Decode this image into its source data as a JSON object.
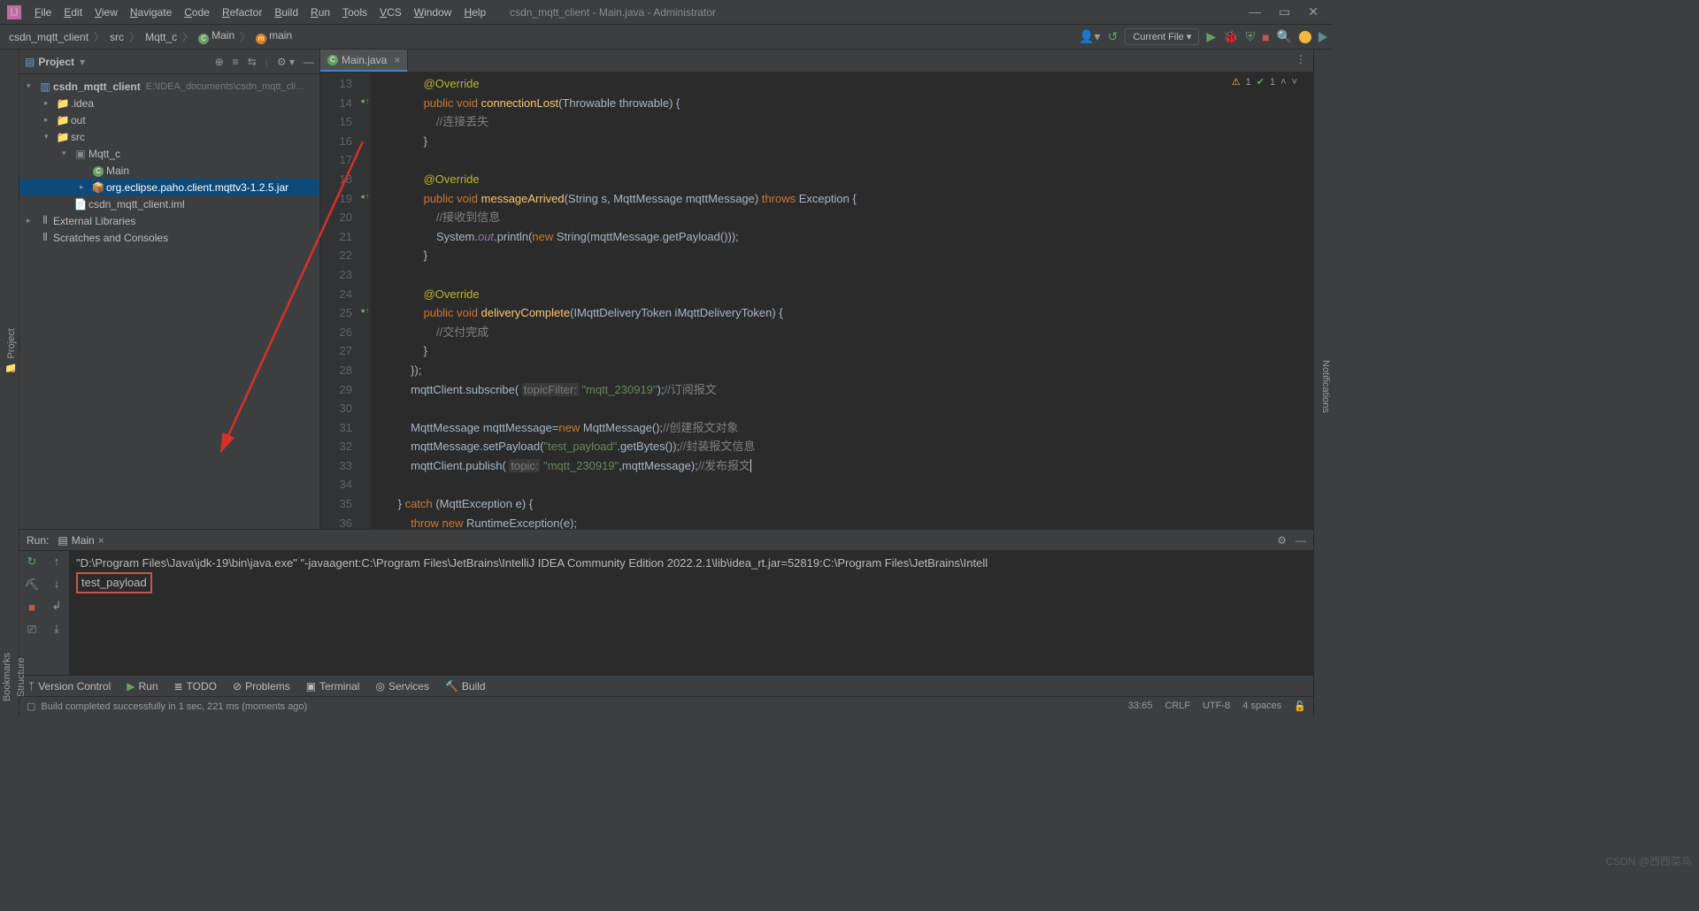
{
  "window": {
    "title": "csdn_mqtt_client - Main.java - Administrator",
    "menus": [
      "File",
      "Edit",
      "View",
      "Navigate",
      "Code",
      "Refactor",
      "Build",
      "Run",
      "Tools",
      "VCS",
      "Window",
      "Help"
    ]
  },
  "breadcrumbs": {
    "items": [
      "csdn_mqtt_client",
      "src",
      "Mqtt_c",
      "Main",
      "main"
    ]
  },
  "toolbar_right": {
    "current_file": "Current File"
  },
  "project_panel": {
    "title": "Project",
    "root": {
      "name": "csdn_mqtt_client",
      "path": "E:\\IDEA_documents\\csdn_mqtt_cli…"
    },
    "nodes": {
      "idea": ".idea",
      "out": "out",
      "src": "src",
      "pkg": "Mqtt_c",
      "main": "Main",
      "jar": "org.eclipse.paho.client.mqttv3-1.2.5.jar",
      "iml": "csdn_mqtt_client.iml",
      "ext": "External Libraries",
      "scratch": "Scratches and Consoles"
    }
  },
  "editor": {
    "tab": "Main.java",
    "warnings": "1",
    "oks": "1",
    "line_start": 13,
    "lines": [
      {
        "n": 13,
        "html": "              <span class='ann'>@Override</span>"
      },
      {
        "n": 14,
        "html": "              <span class='kw'>public void</span> <span class='fn'>connectionLost</span>(Throwable throwable) {",
        "m": 1
      },
      {
        "n": 15,
        "html": "                  <span class='cmt'>//连接丢失</span>"
      },
      {
        "n": 16,
        "html": "              }"
      },
      {
        "n": 17,
        "html": ""
      },
      {
        "n": 18,
        "html": "              <span class='ann'>@Override</span>"
      },
      {
        "n": 19,
        "html": "              <span class='kw'>public void</span> <span class='fn'>messageArrived</span>(String s, MqttMessage mqttMessage) <span class='kw'>throws</span> Exception {",
        "m": 1
      },
      {
        "n": 20,
        "html": "                  <span class='cmt'>//接收到信息</span>"
      },
      {
        "n": 21,
        "html": "                  System.<span class='out'>out</span>.println(<span class='kw'>new</span> String(mqttMessage.getPayload()));"
      },
      {
        "n": 22,
        "html": "              }"
      },
      {
        "n": 23,
        "html": ""
      },
      {
        "n": 24,
        "html": "              <span class='ann'>@Override</span>"
      },
      {
        "n": 25,
        "html": "              <span class='kw'>public void</span> <span class='fn'>deliveryComplete</span>(IMqttDeliveryToken iMqttDeliveryToken) {",
        "m": 1
      },
      {
        "n": 26,
        "html": "                  <span class='cmt'>//交付完成</span>"
      },
      {
        "n": 27,
        "html": "              }"
      },
      {
        "n": 28,
        "html": "          });"
      },
      {
        "n": 29,
        "html": "          mqttClient.subscribe( <span class='hint'>topicFilter:</span> <span class='str'>\"mqtt_230919\"</span>);<span class='cmt'>//订阅报文</span>"
      },
      {
        "n": 30,
        "html": ""
      },
      {
        "n": 31,
        "html": "          MqttMessage mqttMessage=<span class='kw'>new</span> MqttMessage();<span class='cmt'>//创建报文对象</span>"
      },
      {
        "n": 32,
        "html": "          mqttMessage.setPayload(<span class='str'>\"test_payload\"</span>.getBytes());<span class='cmt'>//封装报文信息</span>"
      },
      {
        "n": 33,
        "html": "          mqttClient.publish( <span class='hint'>topic:</span> <span class='str'>\"mqtt_230919\"</span>,mqttMessage);<span class='cmt'>//发布报文</span><span class='caret'></span>"
      },
      {
        "n": 34,
        "html": ""
      },
      {
        "n": 35,
        "html": "      } <span class='kw'>catch</span> (MqttException e) {"
      },
      {
        "n": 36,
        "html": "          <span class='kw'>throw new</span> RuntimeException(e);"
      }
    ]
  },
  "run": {
    "label": "Run:",
    "tab": "Main",
    "line1": "\"D:\\Program Files\\Java\\jdk-19\\bin\\java.exe\" \"-javaagent:C:\\Program Files\\JetBrains\\IntelliJ IDEA Community Edition 2022.2.1\\lib\\idea_rt.jar=52819:C:\\Program Files\\JetBrains\\Intell",
    "line2": "test_payload"
  },
  "bottom_tabs": {
    "version": "Version Control",
    "run": "Run",
    "todo": "TODO",
    "problems": "Problems",
    "terminal": "Terminal",
    "services": "Services",
    "build": "Build"
  },
  "status": {
    "msg": "Build completed successfully in 1 sec, 221 ms (moments ago)",
    "pos": "33:65",
    "sep": "CRLF",
    "enc": "UTF-8",
    "indent": "4 spaces"
  },
  "left_tabs": {
    "project": "Project"
  },
  "left_bottom_tabs": {
    "structure": "Structure",
    "bookmarks": "Bookmarks"
  },
  "right_tabs": {
    "notifications": "Notifications"
  },
  "watermark": "CSDN @西西菜鸟"
}
